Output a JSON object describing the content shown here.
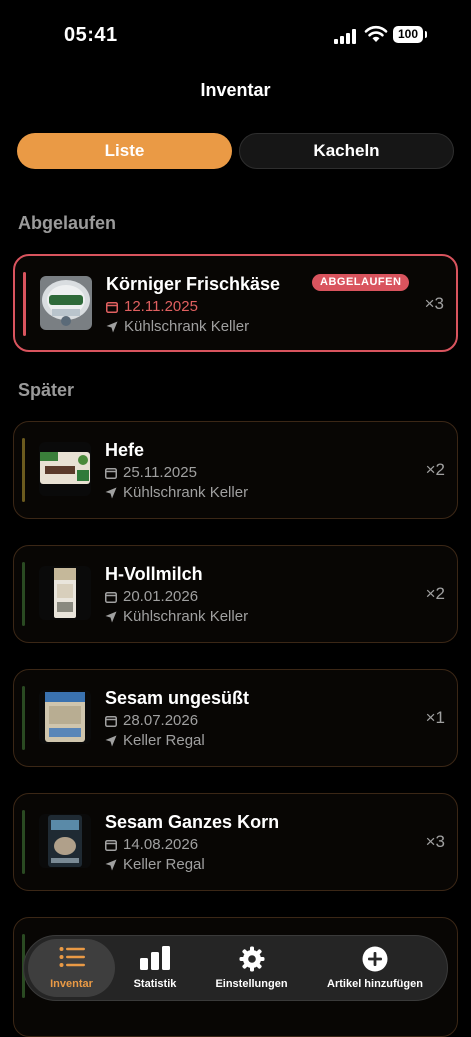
{
  "status": {
    "time": "05:41",
    "battery": "100"
  },
  "header": {
    "title": "Inventar"
  },
  "segments": {
    "list": "Liste",
    "tiles": "Kacheln"
  },
  "sections": {
    "expired": "Abgelaufen",
    "later": "Später"
  },
  "expired_items": [
    {
      "name": "Körniger Frischkäse",
      "badge": "ABGELAUFEN",
      "date": "12.11.2025",
      "location": "Kühlschrank Keller",
      "qty": "×3",
      "accent": "#d9545e"
    }
  ],
  "later_items": [
    {
      "name": "Hefe",
      "date": "25.11.2025",
      "location": "Kühlschrank Keller",
      "qty": "×2",
      "accent": "#6b5a1e"
    },
    {
      "name": "H-Vollmilch",
      "date": "20.01.2026",
      "location": "Kühlschrank Keller",
      "qty": "×2",
      "accent": "#2a4a22"
    },
    {
      "name": "Sesam ungesüßt",
      "date": "28.07.2026",
      "location": "Keller Regal",
      "qty": "×1",
      "accent": "#2a4a22"
    },
    {
      "name": "Sesam Ganzes Korn",
      "date": "14.08.2026",
      "location": "Keller Regal",
      "qty": "×3",
      "accent": "#2a4a22"
    }
  ],
  "tabbar": {
    "inventory": "Inventar",
    "statistics": "Statistik",
    "settings": "Einstellungen",
    "add": "Artikel hinzufügen"
  },
  "colors": {
    "accent": "#ea9a45",
    "expired": "#d9545e"
  }
}
